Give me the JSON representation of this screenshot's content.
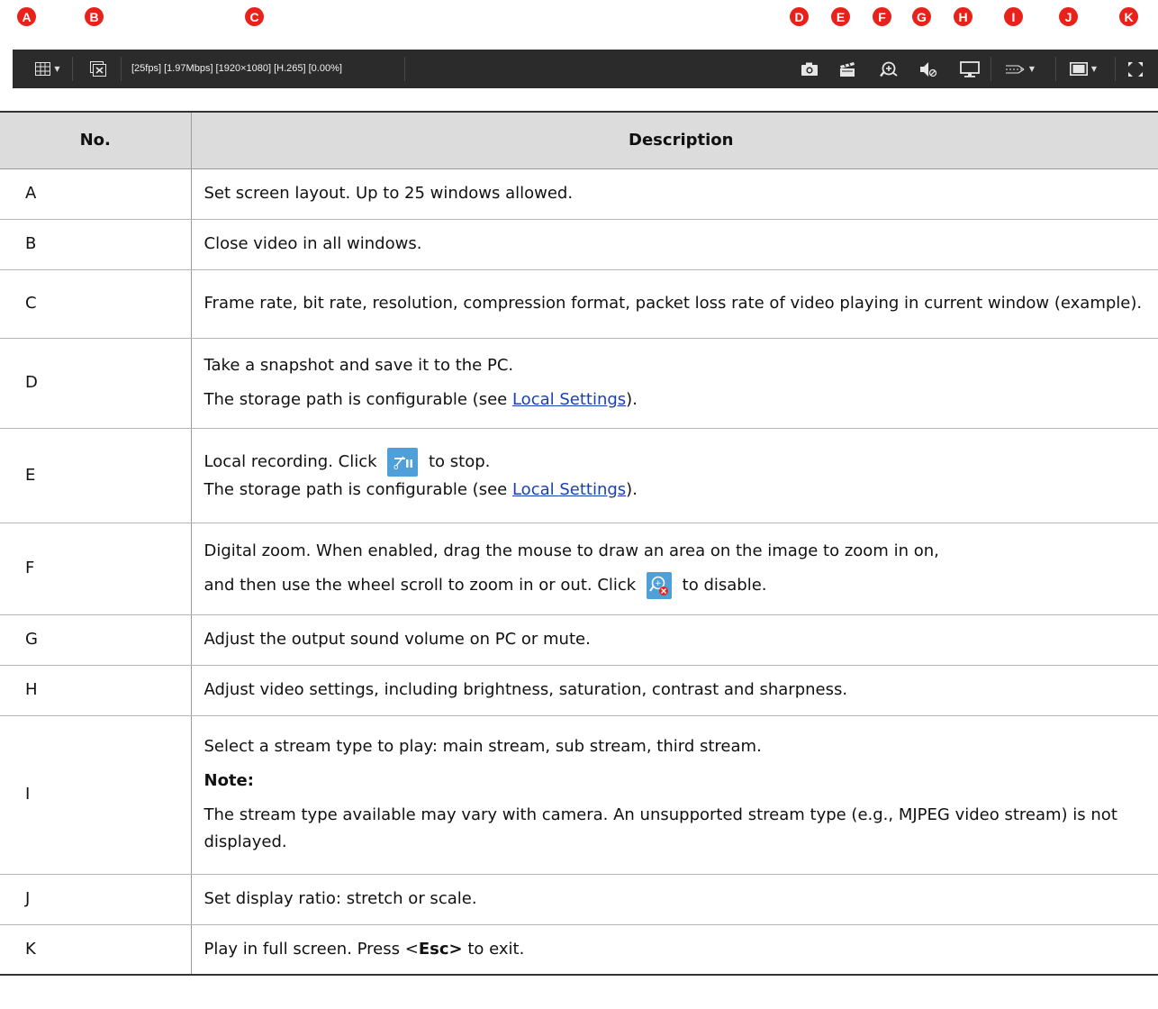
{
  "markers": [
    "A",
    "B",
    "C",
    "D",
    "E",
    "F",
    "G",
    "H",
    "I",
    "J",
    "K"
  ],
  "toolbar": {
    "stats": "[25fps] [1.97Mbps] [1920×1080] [H.265] [0.00%]",
    "caret": "▼",
    "icons": [
      "layout-grid-icon",
      "close-all-icon",
      "camera-icon",
      "clapperboard-icon",
      "zoom-icon",
      "speaker-icon",
      "monitor-icon",
      "stream-icon",
      "display-ratio-icon",
      "fullscreen-icon"
    ]
  },
  "table": {
    "headers": {
      "no": "No.",
      "description": "Description"
    },
    "rows": [
      {
        "no": "A",
        "lines": [
          "Set screen layout. Up to 25 windows allowed."
        ]
      },
      {
        "no": "B",
        "lines": [
          "Close video in all windows."
        ]
      },
      {
        "no": "C",
        "lines": [
          "Frame rate, bit rate, resolution, compression format, packet loss rate of video playing in current window (example)."
        ]
      },
      {
        "no": "D",
        "line1": "Take a snapshot and save it to the PC.",
        "line2_pre": "The storage path is configurable (see ",
        "link": "Local Settings",
        "line2_post": ")."
      },
      {
        "no": "E",
        "line1_pre": "Local recording. Click ",
        "line1_post": " to stop.",
        "line2_pre": "The storage path is configurable (see ",
        "link": "Local Settings",
        "line2_post": ")."
      },
      {
        "no": "F",
        "line1": "Digital zoom. When enabled, drag the mouse to draw an area on the image to zoom in on,",
        "line2_pre": "and then use the wheel scroll to zoom in or out. Click ",
        "line2_post": " to disable."
      },
      {
        "no": "G",
        "lines": [
          "Adjust the output sound volume on PC or mute."
        ]
      },
      {
        "no": "H",
        "lines": [
          "Adjust video settings, including brightness, saturation, contrast and sharpness."
        ]
      },
      {
        "no": "I",
        "line1": "Select a stream type to play: main stream, sub stream, third stream.",
        "note_label": "Note:",
        "note_text": "The stream type available may vary with camera. An unsupported stream type (e.g., MJPEG video stream) is not displayed."
      },
      {
        "no": "J",
        "lines": [
          "Set display ratio: stretch or scale."
        ]
      },
      {
        "no": "K",
        "pre": "Play in full screen. Press <",
        "bold": "Esc>",
        "post": " to exit."
      }
    ]
  }
}
